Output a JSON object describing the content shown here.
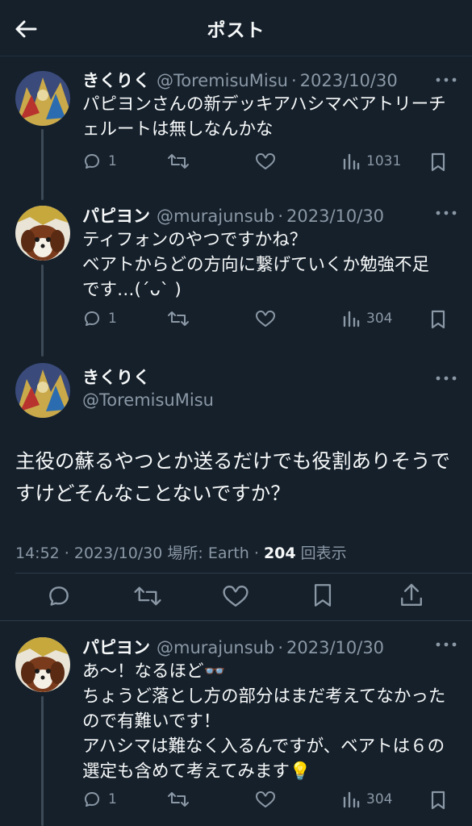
{
  "header": {
    "title": "ポスト"
  },
  "tweets": [
    {
      "name": "きくりく",
      "handle": "@ToremisuMisu",
      "sep": "·",
      "date": "2023/10/30",
      "text": "パピヨンさんの新デッキアハシマベアトリーチ\nェルートは無しなんかな",
      "replies": "1",
      "views": "1031"
    },
    {
      "name": "パピヨン",
      "handle": "@murajunsub",
      "sep": "·",
      "date": "2023/10/30",
      "text": "ティフォンのやつですかね？\nベアトからどの方向に繋げていくか勉強不足\nです…(´ᴗ` )",
      "replies": "1",
      "views": "304"
    },
    {
      "name": "パピヨン",
      "handle": "@murajunsub",
      "sep": "·",
      "date": "2023/10/30",
      "text": "あ〜！なるほど👓\nちょうど落とし方の部分はまだ考えてなかった\nので有難いです！\nアハシマは難なく入るんですが、ベアトは６の\n選定も含めて考えてみます💡",
      "replies": "1",
      "views": "304"
    }
  ],
  "main": {
    "name": "きくりく",
    "handle": "@ToremisuMisu",
    "text": "主役の蘇るやつとか送るだけでも役割ありそうで\nすけどそんなことないですか？",
    "time": "14:52 · 2023/10/30 場所: Earth · ",
    "views": "204",
    "views_label": " 回表示"
  },
  "colors": {
    "background": "#15202b",
    "text": "#f7f9f9",
    "secondary": "#8b98a5",
    "thread_line": "#3d4a56"
  }
}
